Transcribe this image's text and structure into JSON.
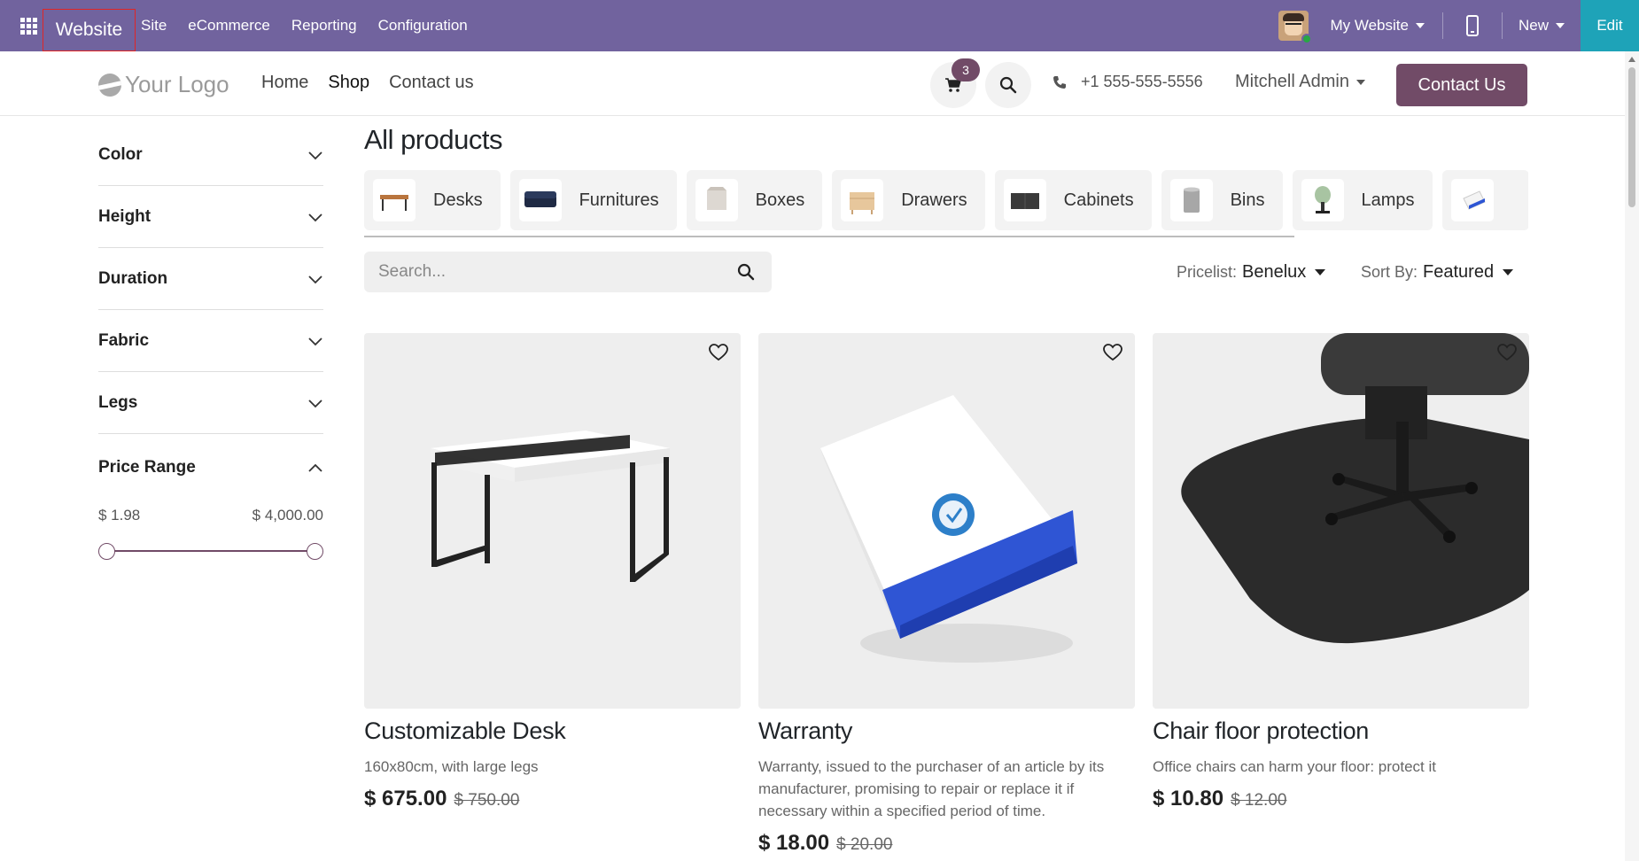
{
  "topbar": {
    "app_name": "Website",
    "menu": [
      "Site",
      "eCommerce",
      "Reporting",
      "Configuration"
    ],
    "my_website": "My Website",
    "new_label": "New",
    "edit_label": "Edit",
    "accent": "#71639e",
    "edit_color": "#1ea3b8"
  },
  "header": {
    "logo_text": "Your Logo",
    "nav": [
      "Home",
      "Shop",
      "Contact us"
    ],
    "cart_count": "3",
    "phone": "+1 555-555-5556",
    "user": "Mitchell Admin",
    "contact_button": "Contact Us",
    "brand_color": "#714b67"
  },
  "filters": {
    "items": [
      "Color",
      "Height",
      "Duration",
      "Fabric",
      "Legs"
    ],
    "price_range_title": "Price Range",
    "price_min": "$ 1.98",
    "price_max": "$ 4,000.00"
  },
  "main": {
    "title": "All products",
    "categories": [
      "Desks",
      "Furnitures",
      "Boxes",
      "Drawers",
      "Cabinets",
      "Bins",
      "Lamps"
    ],
    "search_placeholder": "Search...",
    "pricelist_label": "Pricelist:",
    "pricelist_value": "Benelux",
    "sort_label": "Sort By:",
    "sort_value": "Featured"
  },
  "products": [
    {
      "name": "Customizable Desk",
      "desc": "160x80cm, with large legs",
      "price": "$ 675.00",
      "old_price": "$ 750.00"
    },
    {
      "name": "Warranty",
      "desc": "Warranty, issued to the purchaser of an article by its manufacturer, promising to repair or replace it if necessary within a specified period of time.",
      "price": "$ 18.00",
      "old_price": "$ 20.00"
    },
    {
      "name": "Chair floor protection",
      "desc": "Office chairs can harm your floor: protect it",
      "price": "$ 10.80",
      "old_price": "$ 12.00"
    }
  ],
  "icons": {
    "apps": "apps-grid-icon",
    "mobile": "mobile-phone-icon",
    "cart": "shopping-cart-icon",
    "search": "search-icon",
    "phone": "phone-icon",
    "chevron": "chevron-down-icon",
    "wishlist": "heart-icon"
  }
}
